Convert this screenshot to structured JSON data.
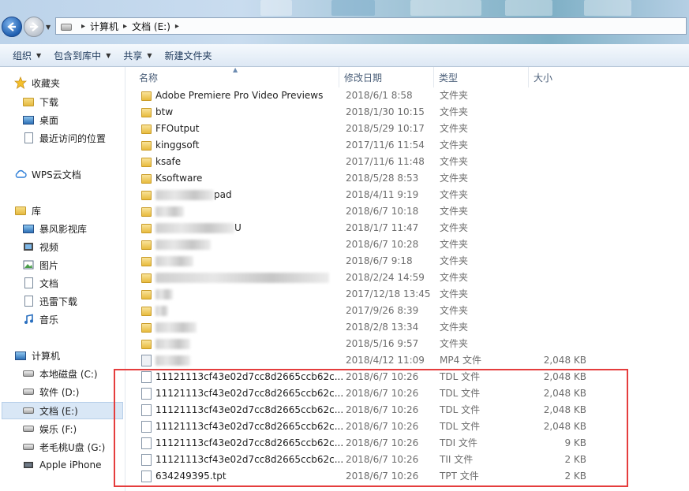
{
  "address": {
    "segments": [
      "计算机",
      "文档 (E:)"
    ]
  },
  "toolbar": {
    "organize": "组织",
    "include_library": "包含到库中",
    "share": "共享",
    "new_folder": "新建文件夹"
  },
  "sidebar": {
    "favorites": {
      "label": "收藏夹",
      "items": [
        "下载",
        "桌面",
        "最近访问的位置"
      ]
    },
    "wps": "WPS云文档",
    "libraries": {
      "label": "库",
      "items": [
        "暴风影视库",
        "视频",
        "图片",
        "文档",
        "迅雷下载",
        "音乐"
      ]
    },
    "computer": {
      "label": "计算机",
      "items": [
        "本地磁盘 (C:)",
        "软件 (D:)",
        "文档 (E:)",
        "娱乐 (F:)",
        "老毛桃U盘 (G:)",
        "Apple iPhone"
      ]
    },
    "selected": "文档 (E:)"
  },
  "columns": {
    "name": "名称",
    "modified": "修改日期",
    "type": "类型",
    "size": "大小"
  },
  "files": [
    {
      "name": "Adobe Premiere Pro Video Previews",
      "date": "2018/6/1 8:58",
      "type": "文件夹",
      "size": "",
      "kind": "folder"
    },
    {
      "name": "btw",
      "date": "2018/1/30 10:15",
      "type": "文件夹",
      "size": "",
      "kind": "folder"
    },
    {
      "name": "FFOutput",
      "date": "2018/5/29 10:17",
      "type": "文件夹",
      "size": "",
      "kind": "folder"
    },
    {
      "name": "kinggsoft",
      "date": "2017/11/6 11:54",
      "type": "文件夹",
      "size": "",
      "kind": "folder"
    },
    {
      "name": "ksafe",
      "date": "2017/11/6 11:48",
      "type": "文件夹",
      "size": "",
      "kind": "folder"
    },
    {
      "name": "Ksoftware",
      "date": "2018/5/28 8:53",
      "type": "文件夹",
      "size": "",
      "kind": "folder"
    },
    {
      "name": "pad",
      "date": "2018/4/11 9:19",
      "type": "文件夹",
      "size": "",
      "kind": "folder",
      "redacted": true
    },
    {
      "name": "",
      "date": "2018/6/7 10:18",
      "type": "文件夹",
      "size": "",
      "kind": "folder",
      "redacted": true
    },
    {
      "name": "U",
      "date": "2018/1/7 11:47",
      "type": "文件夹",
      "size": "",
      "kind": "folder",
      "redacted": true
    },
    {
      "name": "",
      "date": "2018/6/7 10:28",
      "type": "文件夹",
      "size": "",
      "kind": "folder",
      "redacted": true
    },
    {
      "name": "",
      "date": "2018/6/7 9:18",
      "type": "文件夹",
      "size": "",
      "kind": "folder",
      "redacted": true
    },
    {
      "name": "",
      "date": "2018/2/24 14:59",
      "type": "文件夹",
      "size": "",
      "kind": "folder",
      "redacted": true
    },
    {
      "name": "",
      "date": "2017/12/18 13:45",
      "type": "文件夹",
      "size": "",
      "kind": "folder",
      "redacted": true
    },
    {
      "name": "",
      "date": "2017/9/26 8:39",
      "type": "文件夹",
      "size": "",
      "kind": "folder",
      "redacted": true
    },
    {
      "name": "",
      "date": "2018/2/8 13:34",
      "type": "文件夹",
      "size": "",
      "kind": "folder",
      "redacted": true
    },
    {
      "name": "",
      "date": "2018/5/16 9:57",
      "type": "文件夹",
      "size": "",
      "kind": "folder",
      "redacted": true
    },
    {
      "name": "",
      "date": "2018/4/12 11:09",
      "type": "MP4 文件",
      "size": "2,048 KB",
      "kind": "mp4",
      "redacted": true
    },
    {
      "name": "11121113cf43e02d7cc8d2665ccb62c...",
      "date": "2018/6/7 10:26",
      "type": "TDL 文件",
      "size": "2,048 KB",
      "kind": "file"
    },
    {
      "name": "11121113cf43e02d7cc8d2665ccb62c...",
      "date": "2018/6/7 10:26",
      "type": "TDL 文件",
      "size": "2,048 KB",
      "kind": "file"
    },
    {
      "name": "11121113cf43e02d7cc8d2665ccb62c...",
      "date": "2018/6/7 10:26",
      "type": "TDL 文件",
      "size": "2,048 KB",
      "kind": "file"
    },
    {
      "name": "11121113cf43e02d7cc8d2665ccb62c...",
      "date": "2018/6/7 10:26",
      "type": "TDL 文件",
      "size": "2,048 KB",
      "kind": "file"
    },
    {
      "name": "11121113cf43e02d7cc8d2665ccb62c...",
      "date": "2018/6/7 10:26",
      "type": "TDI 文件",
      "size": "9 KB",
      "kind": "file"
    },
    {
      "name": "11121113cf43e02d7cc8d2665ccb62c...",
      "date": "2018/6/7 10:26",
      "type": "TII 文件",
      "size": "2 KB",
      "kind": "file"
    },
    {
      "name": "634249395.tpt",
      "date": "2018/6/7 10:26",
      "type": "TPT 文件",
      "size": "2 KB",
      "kind": "file"
    }
  ],
  "colors": {
    "highlight": "#e53d3d",
    "selection": "#d9e7f6",
    "header_text": "#4c607a"
  }
}
